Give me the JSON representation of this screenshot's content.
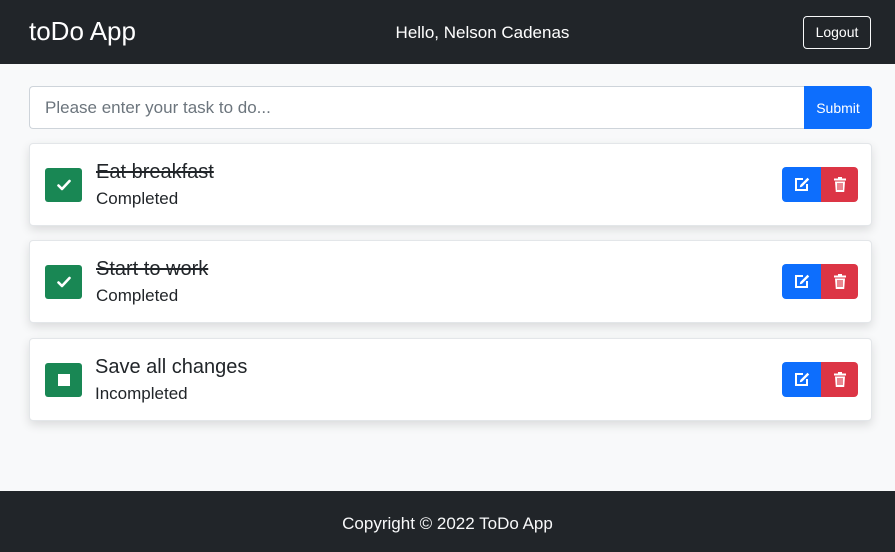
{
  "navbar": {
    "brand": "toDo App",
    "greeting": "Hello, Nelson Cadenas",
    "logout_label": "Logout"
  },
  "form": {
    "placeholder": "Please enter your task to do...",
    "value": "",
    "submit_label": "Submit"
  },
  "tasks": [
    {
      "title": "Eat breakfast",
      "status": "Completed",
      "completed": true
    },
    {
      "title": "Start to work",
      "status": "Completed",
      "completed": true
    },
    {
      "title": "Save all changes",
      "status": "Incompleted",
      "completed": false
    }
  ],
  "icons": {
    "checked": "check-icon",
    "unchecked": "square-icon",
    "edit": "edit-icon",
    "delete": "trash-icon"
  },
  "colors": {
    "primary": "#0d6efd",
    "success": "#198754",
    "danger": "#dc3545",
    "dark": "#212529"
  },
  "footer": {
    "copyright": "Copyright © 2022 ToDo App"
  }
}
